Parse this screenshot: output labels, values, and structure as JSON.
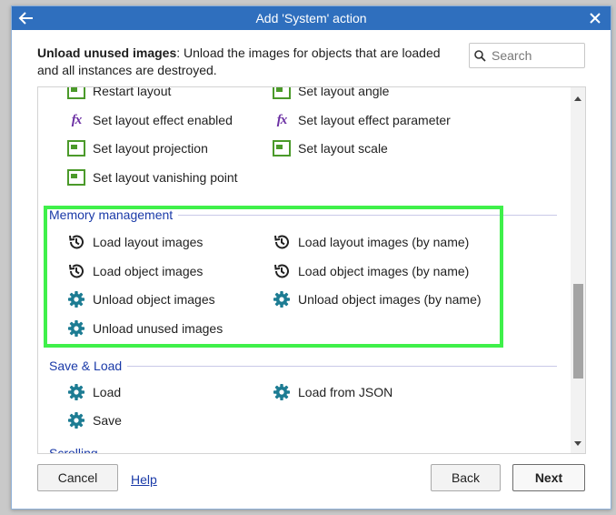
{
  "titlebar": {
    "title": "Add 'System' action",
    "back_icon": "arrow-left-icon",
    "close_icon": "close-icon"
  },
  "description": {
    "bold": "Unload unused images",
    "text": ": Unload the images for objects that are loaded and all instances are destroyed."
  },
  "search": {
    "placeholder": "Search",
    "value": ""
  },
  "layout_items": [
    {
      "label": "Restart layout",
      "icon": "layout-icon"
    },
    {
      "label": "Set layout angle",
      "icon": "layout-icon"
    },
    {
      "label": "Set layout effect enabled",
      "icon": "fx-icon"
    },
    {
      "label": "Set layout effect parameter",
      "icon": "fx-icon"
    },
    {
      "label": "Set layout projection",
      "icon": "layout-icon"
    },
    {
      "label": "Set layout scale",
      "icon": "layout-icon"
    },
    {
      "label": "Set layout vanishing point",
      "icon": "layout-icon"
    }
  ],
  "fx_glyph": "fx",
  "sections": {
    "memory": {
      "title": "Memory management",
      "items": [
        {
          "label": "Load layout images",
          "icon": "history-icon"
        },
        {
          "label": "Load layout images (by name)",
          "icon": "history-icon"
        },
        {
          "label": "Load object images",
          "icon": "history-icon"
        },
        {
          "label": "Load object images (by name)",
          "icon": "history-icon"
        },
        {
          "label": "Unload object images",
          "icon": "gear-icon"
        },
        {
          "label": "Unload object images (by name)",
          "icon": "gear-icon"
        },
        {
          "label": "Unload unused images",
          "icon": "gear-icon"
        }
      ]
    },
    "save_load": {
      "title": "Save & Load",
      "items": [
        {
          "label": "Load",
          "icon": "gear-icon"
        },
        {
          "label": "Load from JSON",
          "icon": "gear-icon"
        },
        {
          "label": "Save",
          "icon": "gear-icon"
        }
      ]
    },
    "scrolling": {
      "title": "Scrolling"
    }
  },
  "footer": {
    "cancel": "Cancel",
    "help": "Help",
    "back": "Back",
    "next": "Next"
  },
  "colors": {
    "titlebar": "#2f6fbe",
    "section_title": "#1a3aa8",
    "highlight": "#3ff04a",
    "gear": "#1d7c93",
    "layout_icon": "#4b9a2a",
    "fx": "#6b2fa3"
  }
}
